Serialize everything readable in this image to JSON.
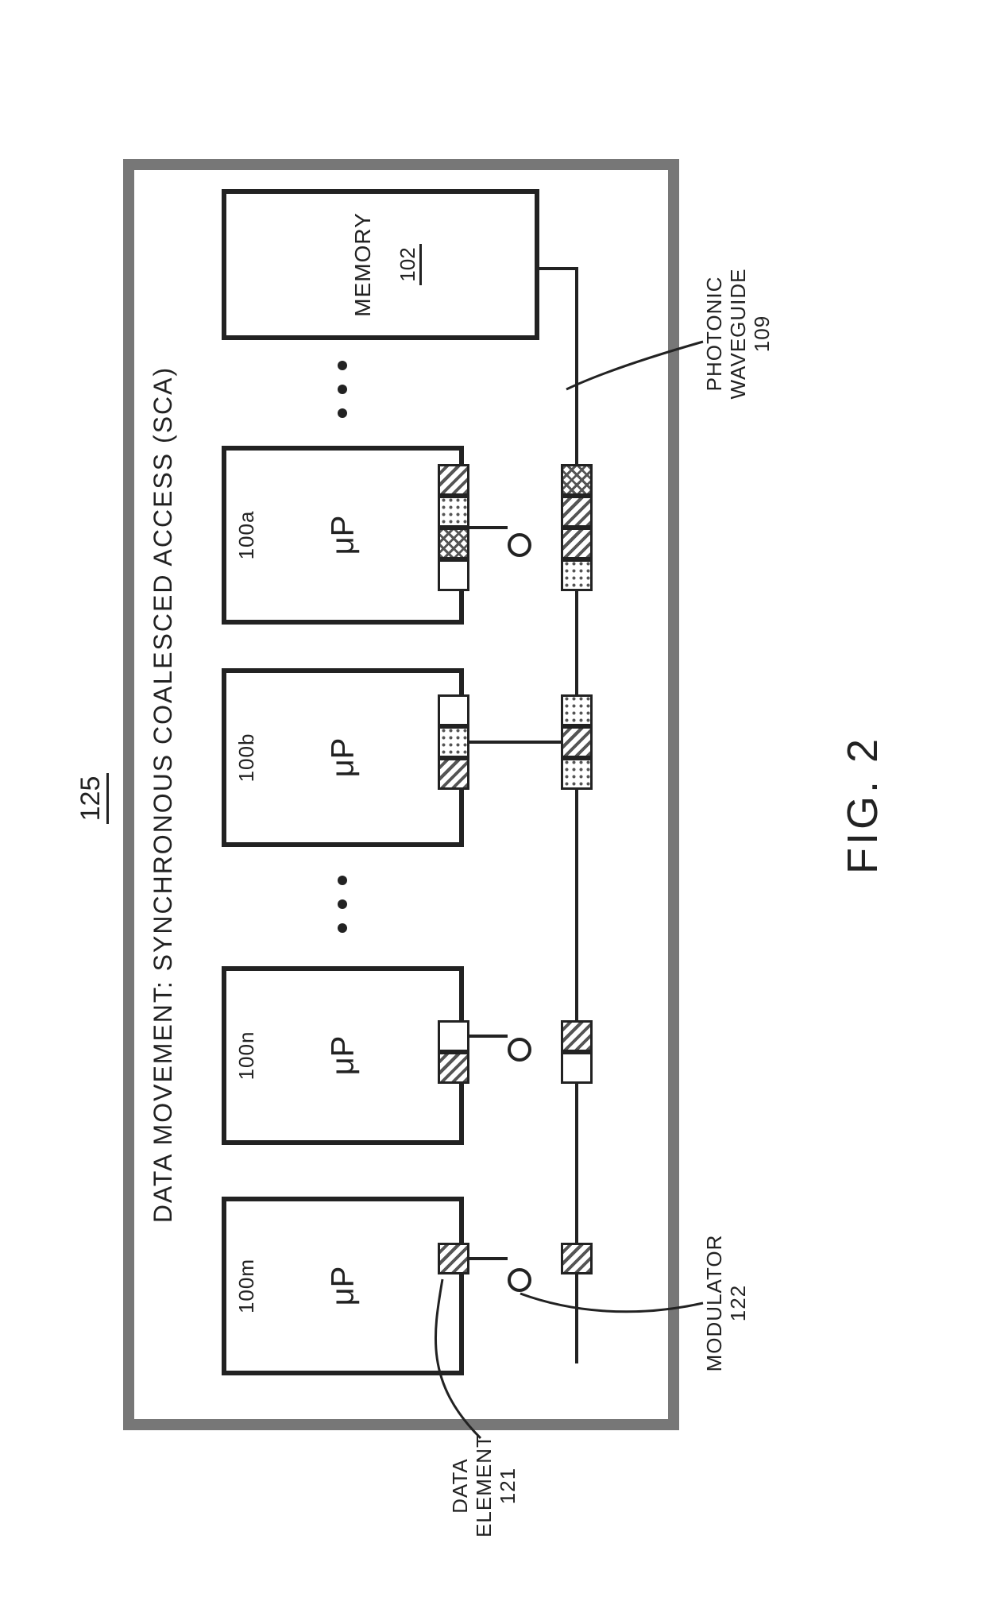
{
  "figure_label": "FIG. 2",
  "outer_ref": "125",
  "outer_title": "DATA MOVEMENT: SYNCHRONOUS COALESCED ACCESS (SCA)",
  "memory": {
    "label": "MEMORY",
    "ref": "102"
  },
  "processors": [
    {
      "id": "100m",
      "mup": "μP"
    },
    {
      "id": "100n",
      "mup": "μP"
    },
    {
      "id": "100b",
      "mup": "μP"
    },
    {
      "id": "100a",
      "mup": "μP"
    }
  ],
  "callouts": {
    "data_element": {
      "label": "DATA\nELEMENT",
      "ref": "121"
    },
    "modulator": {
      "label": "MODULATOR",
      "ref": "122"
    },
    "waveguide": {
      "label": "PHOTONIC\nWAVEGUIDE",
      "ref": "109"
    }
  }
}
